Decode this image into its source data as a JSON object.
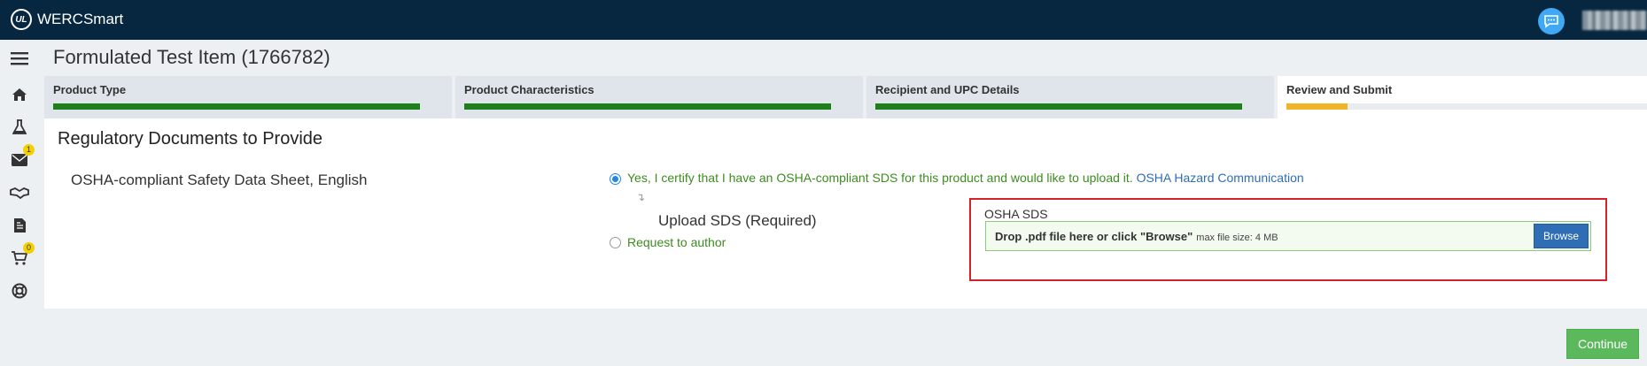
{
  "app": {
    "brand_mark": "UL",
    "brand_name": "WERCSmart"
  },
  "header": {
    "chat_icon": "chat-bubble-icon"
  },
  "sidebar": {
    "icons": [
      {
        "name": "menu-icon"
      },
      {
        "name": "home-icon"
      },
      {
        "name": "flask-icon"
      },
      {
        "name": "mail-icon",
        "badge": "1"
      },
      {
        "name": "handshake-icon"
      },
      {
        "name": "document-icon"
      },
      {
        "name": "cart-icon",
        "badge": "0"
      },
      {
        "name": "lifebuoy-icon"
      }
    ]
  },
  "page": {
    "title": "Formulated Test Item (1766782)"
  },
  "steps": [
    {
      "label": "Product Type",
      "progress": 1.0
    },
    {
      "label": "Product Characteristics",
      "progress": 1.0
    },
    {
      "label": "Recipient and UPC Details",
      "progress": 1.0
    },
    {
      "label": "Review and Submit",
      "progress": 0.17
    }
  ],
  "section": {
    "title": "Regulatory Documents to Provide",
    "document_name": "OSHA-compliant Safety Data Sheet, English",
    "option_upload": "Yes, I certify that I have an OSHA-compliant SDS for this product and would like to upload it.",
    "option_upload_link": "OSHA Hazard Communication",
    "option_upload_selected": true,
    "upload_label": "Upload SDS (Required)",
    "option_author": "Request to author",
    "dropzone": {
      "label": "OSHA SDS",
      "text": "Drop .pdf file here or click \"Browse\"",
      "subtext": "max file size: 4 MB",
      "browse_label": "Browse"
    }
  },
  "footer": {
    "continue_label": "Continue"
  },
  "colors": {
    "header_bg": "#06273f",
    "progress_done": "#1f7f1a",
    "progress_current": "#f0b429",
    "continue_bg": "#5cb85c",
    "browse_bg": "#2f6db5",
    "highlight": "#d6202a"
  }
}
